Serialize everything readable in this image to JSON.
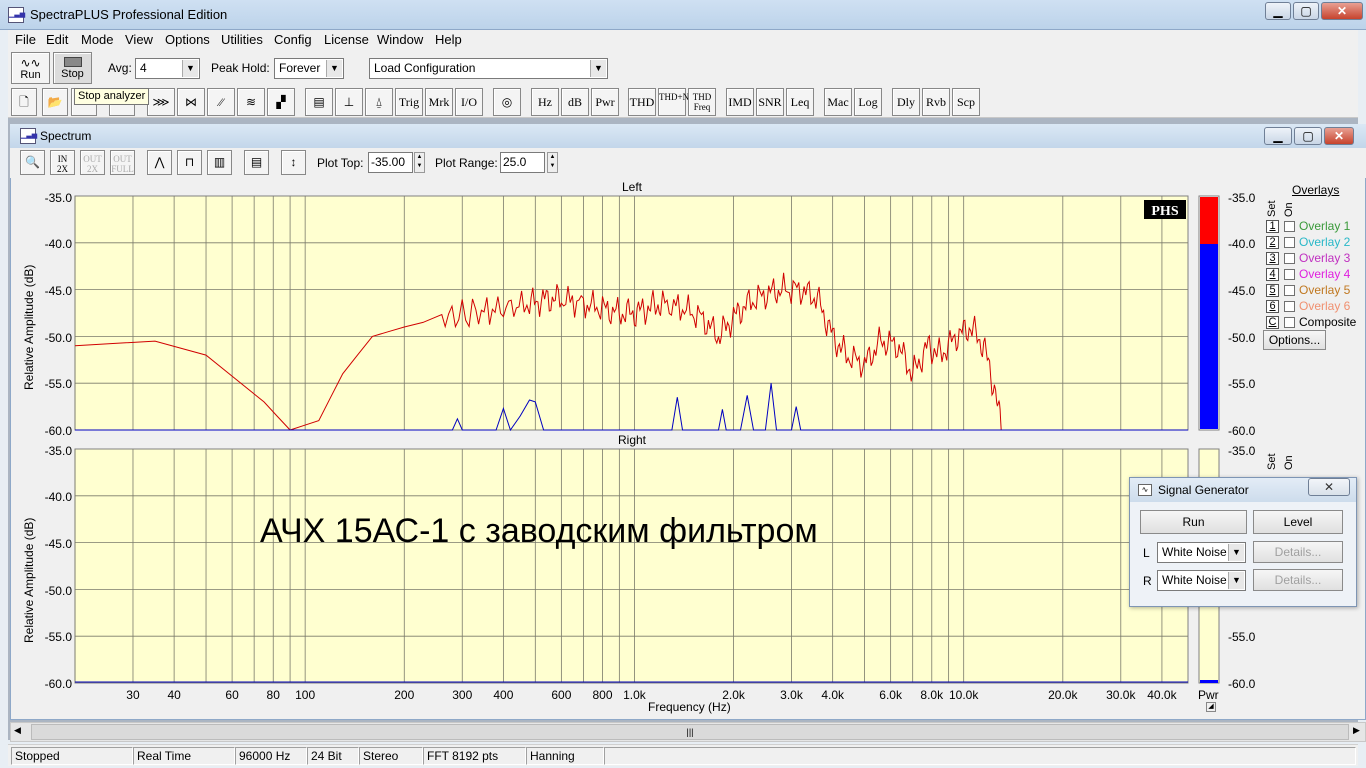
{
  "app": {
    "title": "SpectraPLUS Professional Edition",
    "icon": "spectrum-app-icon"
  },
  "menu": [
    "File",
    "Edit",
    "Mode",
    "View",
    "Options",
    "Utilities",
    "Config",
    "License",
    "Window",
    "Help"
  ],
  "toolbar": {
    "run_label": "Run",
    "stop_label": "Stop",
    "avg_label": "Avg:",
    "avg_value": "4",
    "peak_label": "Peak Hold:",
    "peak_value": "Forever",
    "config_value": "Load Configuration",
    "tooltip": "Stop analyzer",
    "text_buttons": [
      "Trig",
      "Mrk",
      "I/O",
      "Hz",
      "dB",
      "Pwr",
      "THD",
      "THD+N",
      "THD Freq",
      "IMD",
      "SNR",
      "Leq",
      "Mac",
      "Log",
      "Dly",
      "Rvb",
      "Scp"
    ]
  },
  "spectrum": {
    "title": "Spectrum",
    "plot_top_label": "Plot Top:",
    "plot_top_value": "-35.00",
    "plot_range_label": "Plot Range:",
    "plot_range_value": "25.0",
    "left_title": "Left",
    "right_title": "Right",
    "ylabel": "Relative Amplitude (dB)",
    "xlabel": "Frequency (Hz)",
    "badge": "PHS",
    "annotation": "АЧХ 15АС-1 с заводским фильтром",
    "pwr_label": "Pwr",
    "yticks": [
      "-35.0",
      "-40.0",
      "-45.0",
      "-50.0",
      "-55.0",
      "-60.0"
    ],
    "xticks": [
      "30",
      "40",
      "60",
      "80",
      "100",
      "200",
      "300",
      "400",
      "600",
      "800",
      "1.0k",
      "2.0k",
      "3.0k",
      "4.0k",
      "6.0k",
      "8.0k",
      "10.0k",
      "20.0k",
      "30.0k",
      "40.0k"
    ],
    "meter_ticks_left": [
      "-35.0",
      "-40.0",
      "-45.0",
      "-50.0",
      "-55.0",
      "-60.0"
    ],
    "meter_ticks_right": [
      "-35.0",
      "-55.0",
      "-60.0"
    ]
  },
  "overlays": {
    "title": "Overlays",
    "set_label": "Set",
    "on_label": "On",
    "items": [
      {
        "key": "1",
        "name": "Overlay 1",
        "color": "#3a9a3a"
      },
      {
        "key": "2",
        "name": "Overlay 2",
        "color": "#29b8c8"
      },
      {
        "key": "3",
        "name": "Overlay 3",
        "color": "#c030c0"
      },
      {
        "key": "4",
        "name": "Overlay 4",
        "color": "#e020e0"
      },
      {
        "key": "5",
        "name": "Overlay 5",
        "color": "#c07820"
      },
      {
        "key": "6",
        "name": "Overlay 6",
        "color": "#f09070"
      },
      {
        "key": "C",
        "name": "Composite",
        "color": "#000000"
      }
    ],
    "options_label": "Options..."
  },
  "signal_generator": {
    "title": "Signal Generator",
    "run_label": "Run",
    "level_label": "Level",
    "l_label": "L",
    "r_label": "R",
    "l_value": "White Noise",
    "r_value": "White Noise",
    "details_label": "Details..."
  },
  "status": [
    "Stopped",
    "Real Time",
    "96000 Hz",
    "24 Bit",
    "Stereo",
    "FFT 8192 pts",
    "Hanning"
  ],
  "chart_data": {
    "type": "line",
    "x_scale": "log",
    "xlim": [
      20,
      48000
    ],
    "ylim": [
      -60,
      -35
    ],
    "xlabel": "Frequency (Hz)",
    "ylabel": "Relative Amplitude (dB)",
    "series": [
      {
        "name": "Left",
        "color": "#d00000",
        "x": [
          20,
          35,
          50,
          75,
          90,
          110,
          130,
          160,
          200,
          260,
          330,
          400,
          480,
          540,
          600,
          700,
          800,
          900,
          1000,
          1100,
          1200,
          1400,
          1600,
          1800,
          2000,
          2200,
          2500,
          2800,
          3200,
          3600,
          4000,
          4400,
          5000,
          5600,
          6300,
          7000,
          7800,
          8500,
          9500,
          10500,
          11500,
          12500,
          13000
        ],
        "y": [
          -51,
          -50.5,
          -52,
          -57,
          -60,
          -59,
          -54,
          -50,
          -49,
          -48,
          -47.5,
          -47,
          -46.5,
          -46,
          -46,
          -46.5,
          -47,
          -47.5,
          -47.5,
          -47,
          -46.5,
          -47,
          -48,
          -50,
          -48,
          -46.5,
          -45.5,
          -45,
          -45,
          -46,
          -50,
          -52,
          -53,
          -50.5,
          -51,
          -54,
          -51,
          -52,
          -50,
          -49,
          -51,
          -56,
          -60
        ]
      },
      {
        "name": "Left (blue trace)",
        "color": "#0000c0",
        "x": [
          20,
          280,
          290,
          300,
          380,
          400,
          420,
          450,
          480,
          500,
          530,
          1300,
          1350,
          1400,
          1800,
          1850,
          1900,
          2100,
          2200,
          2300,
          2500,
          2600,
          2700,
          3000,
          3100,
          3200,
          3600,
          3700,
          48000
        ],
        "y": [
          -60,
          -60,
          -58.8,
          -60,
          -60,
          -57.7,
          -60,
          -58.5,
          -56.8,
          -57,
          -60,
          -60,
          -56.5,
          -60,
          -60,
          -57.8,
          -60,
          -60,
          -56.3,
          -60,
          -60,
          -55,
          -60,
          -60,
          -57.5,
          -60,
          -60,
          -60,
          -60
        ]
      }
    ]
  }
}
